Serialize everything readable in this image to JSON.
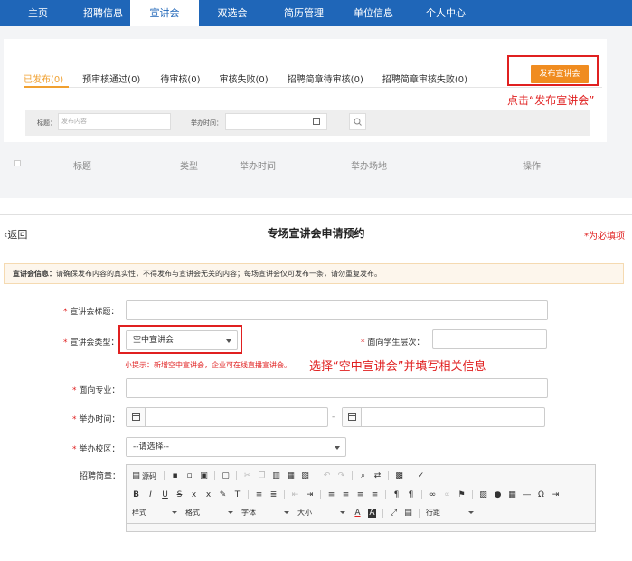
{
  "nav": {
    "items": [
      {
        "label": "主页",
        "active": false
      },
      {
        "label": "招聘信息",
        "active": false
      },
      {
        "label": "宣讲会",
        "active": true
      },
      {
        "label": "双选会",
        "active": false
      },
      {
        "label": "简历管理",
        "active": false
      },
      {
        "label": "单位信息",
        "active": false
      },
      {
        "label": "个人中心",
        "active": false
      }
    ]
  },
  "list": {
    "tabs": [
      {
        "label": "已发布(0)",
        "active": true
      },
      {
        "label": "预审核通过(0)",
        "active": false
      },
      {
        "label": "待审核(0)",
        "active": false
      },
      {
        "label": "审核失败(0)",
        "active": false
      },
      {
        "label": "招聘简章待审核(0)",
        "active": false
      },
      {
        "label": "招聘简章审核失败(0)",
        "active": false
      }
    ],
    "publish_button": "发布宣讲会",
    "publish_hint": "点击“发布宣讲会”",
    "filter": {
      "title_label": "标题：",
      "title_placeholder": "发布内容",
      "time_label": "举办时间："
    },
    "columns": [
      "标题",
      "类型",
      "举办时间",
      "举办场地",
      "操作"
    ]
  },
  "form": {
    "back_label": "返回",
    "title": "专场宣讲会申请预约",
    "required_note": "*为必填项",
    "notice_label": "宣讲会信息：",
    "notice_text": "请确保发布内容的真实性，不得发布与宣讲会无关的内容；每场宣讲会仅可发布一条，请勿重复发布。",
    "fields": {
      "title_label": "宣讲会标题：",
      "type_label": "宣讲会类型：",
      "type_value": "空中宣讲会",
      "student_level_label": "面向学生层次：",
      "major_label": "面向专业：",
      "time_label": "举办时间：",
      "time_separator": "-",
      "campus_label": "举办校区：",
      "campus_value": "--请选择--",
      "brochure_label": "招聘简章："
    },
    "type_tip": "小提示：新增空中宣讲会，企业可在线直播宣讲会。",
    "type_hint": "选择“空中宣讲会”并填写相关信息",
    "editor": {
      "source_label": "源码",
      "font_select": "字体",
      "size_select": "大小",
      "style_select": "样式",
      "format_select": "格式",
      "line_height_select": "行距"
    }
  }
}
